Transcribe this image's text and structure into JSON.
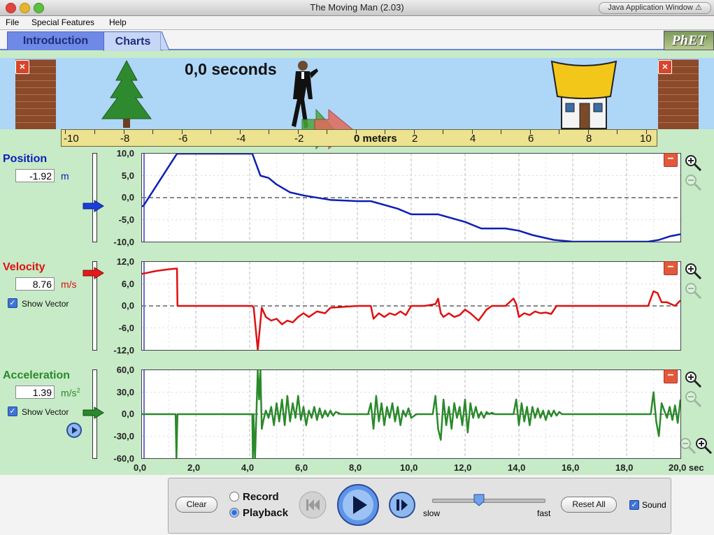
{
  "window": {
    "title": "The Moving Man (2.03)",
    "badge": "Java Application Window"
  },
  "menu": [
    "File",
    "Special Features",
    "Help"
  ],
  "tabs": [
    {
      "label": "Introduction",
      "selected": false
    },
    {
      "label": "Charts",
      "selected": true
    }
  ],
  "logo": "PhET",
  "play_area": {
    "time": "0,0 seconds",
    "ruler_unit": "0 meters"
  },
  "ruler_ticks": [
    "-10",
    "-8",
    "-6",
    "-4",
    "-2",
    "2",
    "4",
    "6",
    "8",
    "10"
  ],
  "panels": {
    "position": {
      "title": "Position",
      "value": "-1.92",
      "unit": "m",
      "color": "#0b1fb6"
    },
    "velocity": {
      "title": "Velocity",
      "value": "8.76",
      "unit": "m/s",
      "color": "#e01010",
      "show_vector": "Show Vector"
    },
    "acceleration": {
      "title": "Acceleration",
      "value": "1.39",
      "unit": "m/s",
      "unit_sup": "2",
      "color": "#2a8a2a",
      "show_vector": "Show Vector"
    }
  },
  "chart_data": [
    {
      "type": "line",
      "name": "Position",
      "ylim": [
        -10,
        10
      ],
      "y_ticks": [
        "10,0",
        "5,0",
        "0,0",
        "-5,0",
        "-10,0"
      ],
      "x": [
        0,
        0.05,
        1.3,
        4.1,
        4.4,
        4.7,
        5.0,
        5.5,
        6.0,
        7.0,
        8.0,
        8.5,
        9.5,
        10.0,
        11.0,
        12.0,
        12.6,
        13.5,
        14.0,
        14.5,
        15.3,
        16.0,
        17.0,
        18.0,
        18.8,
        19.2,
        19.6,
        20.0
      ],
      "y": [
        -1.92,
        -1.9,
        10,
        10,
        5,
        4.5,
        3,
        1.2,
        0.5,
        -0.5,
        -0.8,
        -0.8,
        -2.5,
        -3.8,
        -3.8,
        -5.5,
        -7,
        -7,
        -7.5,
        -8.5,
        -9.6,
        -10,
        -10,
        -10,
        -10,
        -9.6,
        -8.8,
        -8.3
      ]
    },
    {
      "type": "line",
      "name": "Velocity",
      "ylim": [
        -12,
        12
      ],
      "y_ticks": [
        "12,0",
        "6,0",
        "0,0",
        "-6,0",
        "-12,0"
      ],
      "x": [
        0,
        0.05,
        0.5,
        1.0,
        1.3,
        1.32,
        4.1,
        4.15,
        4.3,
        4.45,
        4.6,
        4.8,
        5.0,
        5.2,
        5.4,
        5.6,
        5.8,
        6.0,
        6.2,
        6.5,
        6.8,
        7.0,
        8.0,
        8.5,
        8.6,
        8.8,
        9.0,
        9.2,
        9.4,
        9.6,
        9.8,
        10.0,
        10.5,
        10.9,
        11.0,
        11.1,
        11.2,
        11.4,
        11.6,
        11.8,
        12.0,
        12.2,
        12.5,
        12.8,
        13.0,
        13.5,
        13.8,
        13.9,
        14.0,
        14.2,
        14.4,
        14.6,
        14.8,
        15.0,
        15.2,
        15.4,
        15.6,
        16.0,
        18.8,
        19.0,
        19.15,
        19.3,
        19.5,
        19.8,
        20.0
      ],
      "y": [
        8.76,
        8.8,
        9.5,
        10,
        10.2,
        0,
        0,
        -0.5,
        -12,
        -0.5,
        -3,
        -4,
        -3.5,
        -5,
        -4,
        -4.5,
        -3,
        -2,
        -3,
        -1.5,
        -2,
        -0.5,
        0,
        0,
        -3.5,
        -2,
        -3,
        -2,
        -2.5,
        -1.5,
        -2.5,
        0,
        0,
        0.5,
        2,
        -2,
        -3,
        -2,
        -3,
        -2.5,
        -1,
        -2,
        -4,
        -1,
        0,
        0,
        2,
        0.5,
        -3,
        -2,
        -2.5,
        -1.5,
        -2,
        -1.8,
        -2.2,
        0,
        0,
        0,
        0,
        4,
        3.5,
        1,
        1,
        0,
        1.5
      ]
    },
    {
      "type": "line",
      "name": "Acceleration",
      "ylim": [
        -60,
        60
      ],
      "y_ticks": [
        "60,0",
        "30,0",
        "0,0",
        "-30,0",
        "-60,0"
      ],
      "x": [
        0,
        1.25,
        1.28,
        1.32,
        1.36,
        4.1,
        4.12,
        4.14,
        4.2,
        4.3,
        4.35,
        4.4,
        4.45,
        4.5,
        4.6,
        4.7,
        4.8,
        4.9,
        5.0,
        5.1,
        5.2,
        5.3,
        5.4,
        5.5,
        5.6,
        5.7,
        5.8,
        5.9,
        6.0,
        6.1,
        6.2,
        6.3,
        6.4,
        6.5,
        6.6,
        6.7,
        6.8,
        6.9,
        7.0,
        7.1,
        7.2,
        7.4,
        8.0,
        8.4,
        8.5,
        8.6,
        8.7,
        8.8,
        8.9,
        9.0,
        9.1,
        9.2,
        9.3,
        9.4,
        9.5,
        9.6,
        9.7,
        9.8,
        9.9,
        10.0,
        10.2,
        10.4,
        10.6,
        10.8,
        10.9,
        11.0,
        11.1,
        11.2,
        11.3,
        11.4,
        11.5,
        11.6,
        11.7,
        11.8,
        11.9,
        12.0,
        12.1,
        12.2,
        12.3,
        12.4,
        12.5,
        12.6,
        12.7,
        12.8,
        12.9,
        13.0,
        13.1,
        13.4,
        13.8,
        13.9,
        14.0,
        14.1,
        14.2,
        14.3,
        14.4,
        14.5,
        14.6,
        14.7,
        14.8,
        14.9,
        15.0,
        15.1,
        15.2,
        15.3,
        15.4,
        15.5,
        15.6,
        15.8,
        18.8,
        18.9,
        19.0,
        19.1,
        19.2,
        19.3,
        19.4,
        19.5,
        19.6,
        19.7,
        19.8,
        19.9,
        20.0
      ],
      "y": [
        0,
        0,
        -60,
        0,
        0,
        0,
        -60,
        0,
        -60,
        60,
        20,
        60,
        -20,
        -10,
        5,
        -5,
        10,
        -15,
        15,
        -10,
        20,
        -15,
        25,
        -10,
        15,
        -5,
        25,
        -8,
        10,
        -15,
        5,
        -5,
        10,
        -8,
        8,
        -5,
        5,
        -3,
        5,
        -2,
        3,
        0,
        0,
        0,
        15,
        -20,
        25,
        -10,
        15,
        -15,
        10,
        -5,
        15,
        -10,
        10,
        -15,
        5,
        -3,
        8,
        -5,
        0,
        0,
        0,
        0,
        25,
        -20,
        -35,
        20,
        -15,
        10,
        -20,
        15,
        -5,
        10,
        -15,
        20,
        -25,
        15,
        -5,
        10,
        -5,
        3,
        -5,
        3,
        0,
        2,
        0,
        0,
        0,
        20,
        -15,
        15,
        -10,
        10,
        -15,
        10,
        -5,
        8,
        -5,
        5,
        -8,
        5,
        -3,
        5,
        -2,
        3,
        0,
        0,
        0,
        0,
        30,
        -10,
        -30,
        15,
        5,
        -5,
        10,
        -8,
        12,
        -12,
        20
      ]
    }
  ],
  "x_axis": {
    "ticks": [
      "0,0",
      "2,0",
      "4,0",
      "6,0",
      "8,0",
      "10,0",
      "12,0",
      "14,0",
      "16,0",
      "18,0",
      "20,0 sec"
    ],
    "xlim": [
      0,
      20
    ]
  },
  "controls": {
    "clear": "Clear",
    "record": "Record",
    "playback": "Playback",
    "slow": "slow",
    "fast": "fast",
    "speed_level": 0.42,
    "reset": "Reset All",
    "sound": "Sound"
  }
}
